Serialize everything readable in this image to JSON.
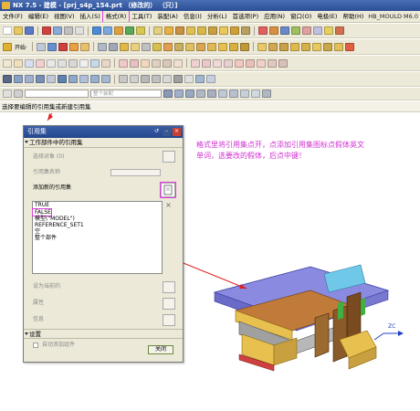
{
  "window": {
    "title": "NX 7.5 - 建模 - [prj_s4p_154.prt （修改的） （只）]"
  },
  "menubar": {
    "items": [
      "文件(F)",
      "编辑(E)",
      "视图(V)",
      "插入(S)",
      "格式(R)",
      "工具(T)",
      "装配(A)",
      "信息(I)",
      "分析(L)",
      "首选项(P)",
      "应用(N)",
      "窗口(O)",
      "电极(E)",
      "帮助(H)"
    ],
    "right_label": "HB_MOULD M6.0"
  },
  "toolbar2": {
    "start_label": "开始·"
  },
  "filter": {
    "placeholder": "整个装配"
  },
  "cue": {
    "text": "选择要编辑的引用集或新建引用集"
  },
  "dialog": {
    "title": "引用集",
    "section_work": "工作部件中的引用集",
    "select_object": "选择对象 (0)",
    "refset_name_label": "引用集名称",
    "add_new_label": "添加新的引用集",
    "list_items": [
      "TRUE",
      "FALSE",
      "模型(\"MODEL\")",
      "REFERENCE_SET1",
      "空",
      "整个部件"
    ],
    "set_current": "设为当前的",
    "properties": "属性",
    "info": "信息",
    "section_settings": "设置",
    "auto_add": "自动添加组件",
    "close": "关闭"
  },
  "annotation": {
    "text": "格式里将引用集点开，点添加引用集图标点假体英文单词，选要改的假体，后点中键！"
  },
  "model": {
    "axis_label": "ZC"
  },
  "colors": {
    "annotation": "#d030d0",
    "highlight": "#e040e0",
    "arrow": "#e02020",
    "titlebar": "#2b4f96"
  }
}
